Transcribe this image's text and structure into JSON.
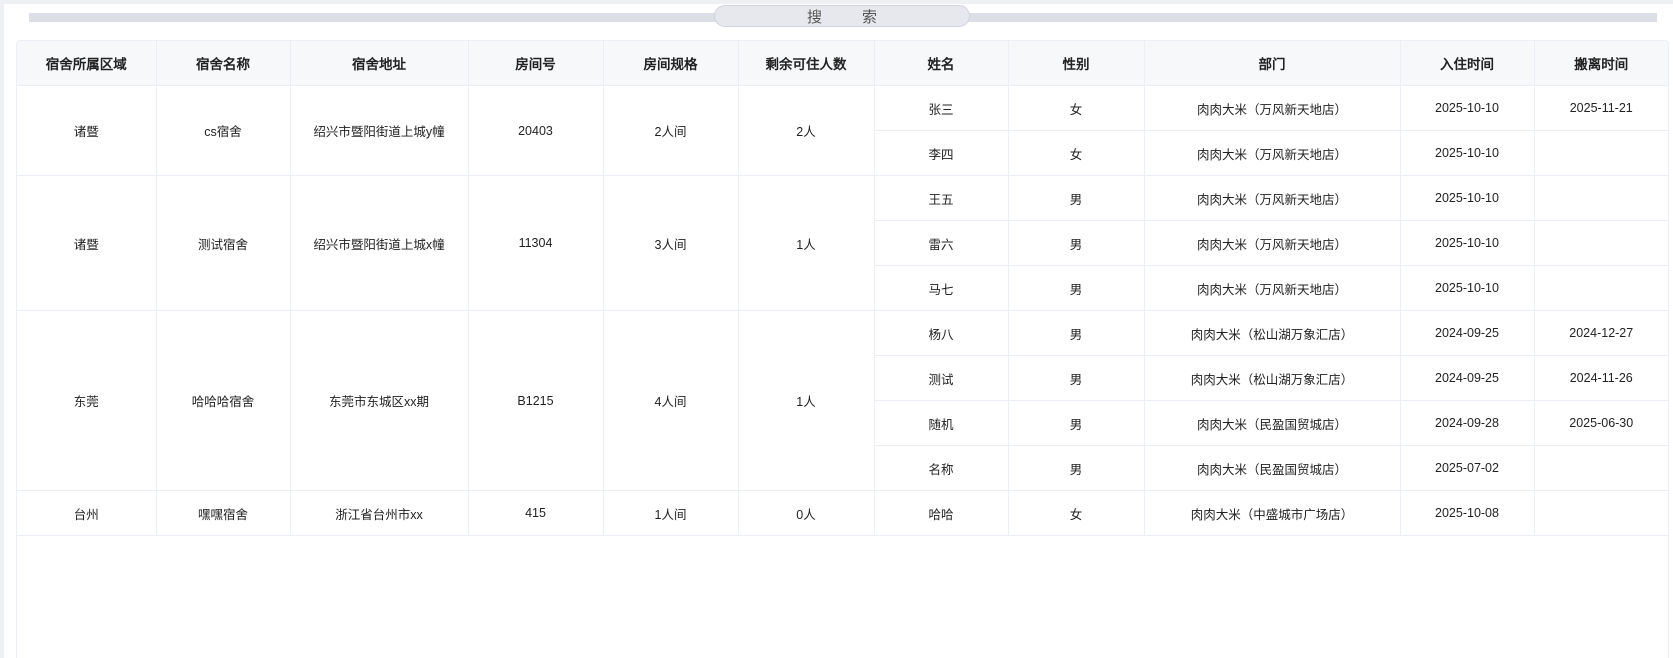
{
  "search": {
    "label": "搜索",
    "chars": [
      "搜",
      "索"
    ]
  },
  "columns": [
    "宿舍所属区域",
    "宿舍名称",
    "宿舍地址",
    "房间号",
    "房间规格",
    "剩余可住人数",
    "姓名",
    "性别",
    "部门",
    "入住时间",
    "搬离时间"
  ],
  "rooms": [
    {
      "area": "诸暨",
      "name": "cs宿舍",
      "address": "绍兴市暨阳街道上城y幢",
      "room": "20403",
      "spec": "2人间",
      "remaining": "2人",
      "residents": [
        {
          "name": "张三",
          "gender": "女",
          "dept": "肉肉大米（万风新天地店）",
          "checkin": "2025-10-10",
          "checkout": "2025-11-21"
        },
        {
          "name": "李四",
          "gender": "女",
          "dept": "肉肉大米（万风新天地店）",
          "checkin": "2025-10-10",
          "checkout": ""
        }
      ]
    },
    {
      "area": "诸暨",
      "name": "测试宿舍",
      "address": "绍兴市暨阳街道上城x幢",
      "room": "11304",
      "spec": "3人间",
      "remaining": "1人",
      "residents": [
        {
          "name": "王五",
          "gender": "男",
          "dept": "肉肉大米（万风新天地店）",
          "checkin": "2025-10-10",
          "checkout": ""
        },
        {
          "name": "雷六",
          "gender": "男",
          "dept": "肉肉大米（万风新天地店）",
          "checkin": "2025-10-10",
          "checkout": ""
        },
        {
          "name": "马七",
          "gender": "男",
          "dept": "肉肉大米（万风新天地店）",
          "checkin": "2025-10-10",
          "checkout": ""
        }
      ]
    },
    {
      "area": "东莞",
      "name": "哈哈哈宿舍",
      "address": "东莞市东城区xx期",
      "room": "B1215",
      "spec": "4人间",
      "remaining": "1人",
      "residents": [
        {
          "name": "杨八",
          "gender": "男",
          "dept": "肉肉大米（松山湖万象汇店）",
          "checkin": "2024-09-25",
          "checkout": "2024-12-27"
        },
        {
          "name": "测试",
          "gender": "男",
          "dept": "肉肉大米（松山湖万象汇店）",
          "checkin": "2024-09-25",
          "checkout": "2024-11-26"
        },
        {
          "name": "随机",
          "gender": "男",
          "dept": "肉肉大米（民盈国贸城店）",
          "checkin": "2024-09-28",
          "checkout": "2025-06-30"
        },
        {
          "name": "名称",
          "gender": "男",
          "dept": "肉肉大米（民盈国贸城店）",
          "checkin": "2025-07-02",
          "checkout": ""
        }
      ]
    },
    {
      "area": "台州",
      "name": "嘿嘿宿舍",
      "address": "浙江省台州市xx",
      "room": "415",
      "spec": "1人间",
      "remaining": "0人",
      "residents": [
        {
          "name": "哈哈",
          "gender": "女",
          "dept": "肉肉大米（中盛城市广场店）",
          "checkin": "2025-10-08",
          "checkout": ""
        }
      ]
    }
  ]
}
